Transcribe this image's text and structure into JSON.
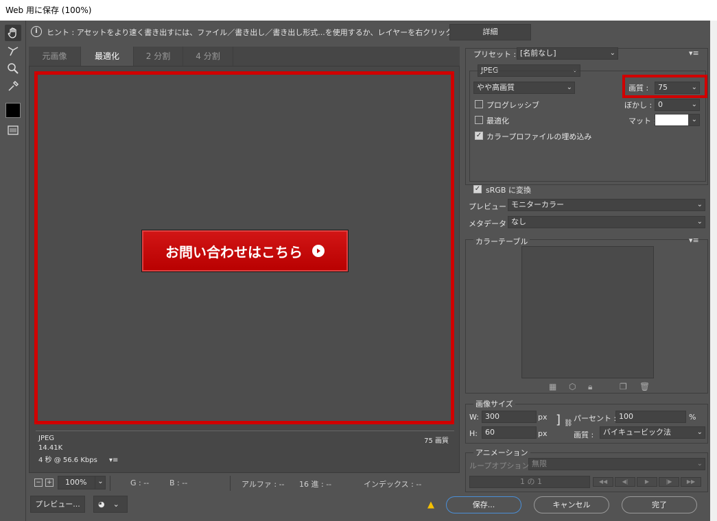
{
  "window": {
    "title": "Web 用に保存 (100%)"
  },
  "hint": {
    "text": "ヒント : アセットをより速く書き出すには、ファイル／書き出し／書き出し形式...を使用するか、レイヤーを右クリックして使用。",
    "detail_button": "詳細"
  },
  "tabs": [
    {
      "label": "元画像",
      "active": false
    },
    {
      "label": "最適化",
      "active": true
    },
    {
      "label": "2 分割",
      "active": false
    },
    {
      "label": "4 分割",
      "active": false
    }
  ],
  "preview": {
    "cta_text": "お問い合わせはこちら",
    "format": "JPEG",
    "size": "14.41K",
    "time": "4 秒 @ 56.6 Kbps",
    "quality": "75 画質"
  },
  "status": {
    "zoom": "100%",
    "g": "G : --",
    "b": "B : --",
    "alpha": "アルファ : --",
    "hex": "16 進 : --",
    "index": "インデックス : --"
  },
  "buttons": {
    "preview": "プレビュー...",
    "save": "保存...",
    "cancel": "キャンセル",
    "done": "完了"
  },
  "settings": {
    "preset_label": "プリセット :",
    "preset_value": "[名前なし]",
    "format": "JPEG",
    "quality_preset": "やや高画質",
    "quality_label": "画質 :",
    "quality_value": "75",
    "progressive_label": "プログレッシブ",
    "progressive": false,
    "blur_label": "ぼかし :",
    "blur_value": "0",
    "optimize_label": "最適化",
    "optimize": false,
    "matte_label": "マット :",
    "embed_profile_label": "カラープロファイルの埋め込み",
    "embed_profile": true,
    "srgb_label": "sRGB に変換",
    "srgb": true,
    "preview_label": "プレビュー :",
    "preview_value": "モニターカラー",
    "metadata_label": "メタデータ :",
    "metadata_value": "なし"
  },
  "color_table": {
    "title": "カラーテーブル"
  },
  "image_size": {
    "title": "画像サイズ",
    "w_label": "W:",
    "w_value": "300",
    "h_label": "H:",
    "h_value": "60",
    "unit": "px",
    "percent_label": "パーセント :",
    "percent_value": "100",
    "percent_unit": "%",
    "quality_label": "画質 :",
    "quality_value": "バイキュービック法"
  },
  "animation": {
    "title": "アニメーション",
    "loop_label": "ループオプション :",
    "loop_value": "無限",
    "frame": "1 の 1"
  },
  "colors": {
    "accent_red": "#d00000",
    "cta_red": "#c80a0a",
    "panel": "#535353"
  }
}
